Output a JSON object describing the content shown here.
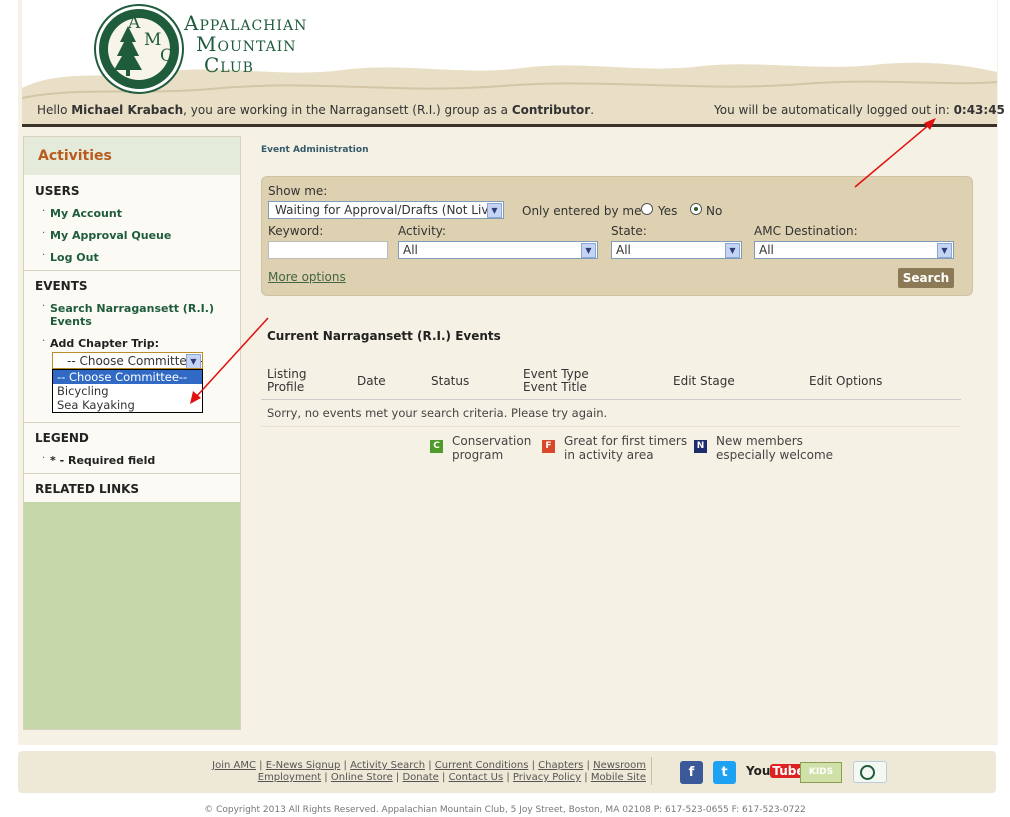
{
  "header": {
    "brand_line1": "Appalachian",
    "brand_line2": "Mountain",
    "brand_line3": "Club",
    "logo_letters": [
      "A",
      "M",
      "C"
    ],
    "hello_prefix": "Hello ",
    "user_name": "Michael Krabach",
    "hello_middle": ", you are working in the Narragansett (R.I.) group as a ",
    "role": "Contributor",
    "hello_suffix": ".",
    "logout_text": "You will be automatically logged out in: ",
    "logout_time": "0:43:45"
  },
  "sidebar": {
    "title": "Activities",
    "users_heading": "USERS",
    "users_links": [
      "My Account",
      "My Approval Queue",
      "Log Out"
    ],
    "events_heading": "EVENTS",
    "search_events": "Search Narragansett (R.I.) Events",
    "add_trip_label": "Add Chapter Trip:",
    "committee_selected": "-- Choose Committee--",
    "committee_options": [
      "-- Choose Committee--",
      "Bicycling",
      "Sea Kayaking"
    ],
    "legend_heading": "LEGEND",
    "legend_item": "* - Required field",
    "related_heading": "RELATED LINKS"
  },
  "main": {
    "breadcrumb": "Event Administration",
    "filters": {
      "show_me_label": "Show me:",
      "show_me_value": "Waiting for Approval/Drafts (Not Live)",
      "only_mine_label": "Only entered by me",
      "yes_label": "Yes",
      "no_label": "No",
      "selected_radio": "No",
      "keyword_label": "Keyword:",
      "keyword_value": "",
      "activity_label": "Activity:",
      "activity_value": "All",
      "state_label": "State:",
      "state_value": "All",
      "destination_label": "AMC Destination:",
      "destination_value": "All",
      "more_options": "More options",
      "search_button": "Search"
    },
    "results": {
      "title": "Current Narragansett (R.I.) Events",
      "columns": [
        "Listing Profile",
        "Date",
        "Status",
        "Event Type Event Title",
        "Edit Stage",
        "Edit Options"
      ],
      "col_listing_1": "Listing",
      "col_listing_2": "Profile",
      "col_type_1": "Event Type",
      "col_type_2": "Event Title",
      "empty_message": "Sorry, no events met your search criteria. Please try again."
    },
    "legend": [
      {
        "letter": "C",
        "color": "#4e9a2a",
        "line1": "Conservation",
        "line2": "program"
      },
      {
        "letter": "F",
        "color": "#d9482b",
        "line1": "Great for first timers",
        "line2": "in activity area"
      },
      {
        "letter": "N",
        "color": "#1d2d6b",
        "line1": "New members",
        "line2": "especially welcome"
      }
    ]
  },
  "footer": {
    "row1": [
      "Join AMC",
      "E-News Signup",
      "Activity Search",
      "Current Conditions",
      "Chapters",
      "Newsroom"
    ],
    "row2": [
      "Employment",
      "Online Store",
      "Donate",
      "Contact Us",
      "Privacy Policy",
      "Mobile Site"
    ],
    "social_icons": [
      "facebook-icon",
      "twitter-icon",
      "youtube-icon",
      "kids-outdoors-icon",
      "amc-outdoors-icon"
    ],
    "youtube_you": "You",
    "youtube_tube": "Tube",
    "kids_text": "KIDS",
    "copyright": "© Copyright 2013 All Rights Reserved. Appalachian Mountain Club, 5 Joy Street, Boston, MA 02108 P: 617-523-0655 F: 617-523-0722"
  },
  "colors": {
    "brand_green": "#1f5c3c",
    "accent_orange": "#b85b1e",
    "panel_tan": "#ddd1b1",
    "annotation_red": "#e01010"
  }
}
